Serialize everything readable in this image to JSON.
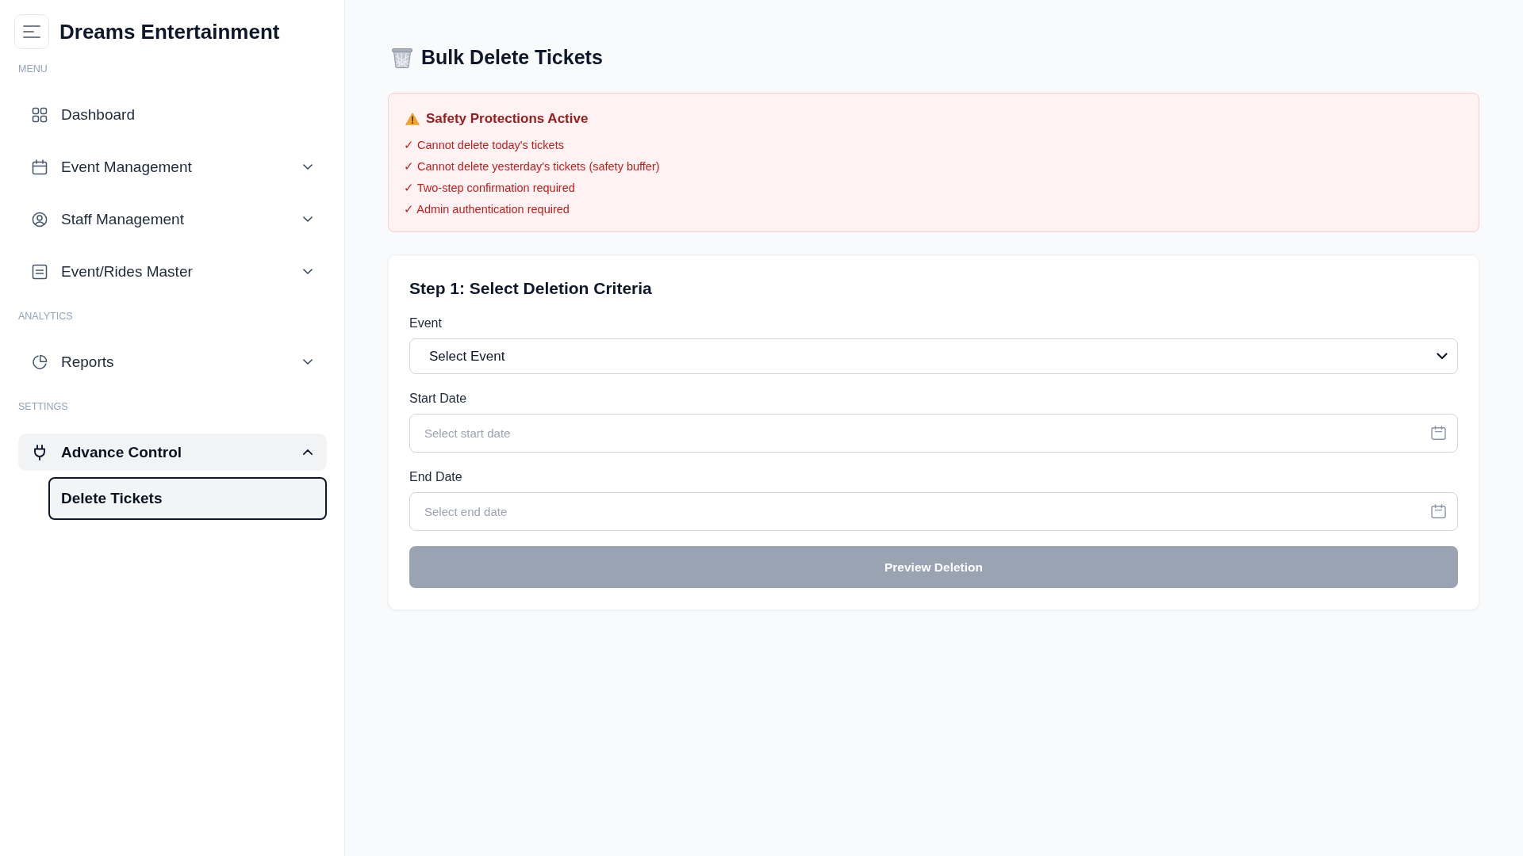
{
  "sidebar": {
    "brand": "Dreams Entertainment",
    "sections": [
      {
        "heading": "MENU",
        "items": [
          {
            "kind": "link",
            "label": "Dashboard",
            "selected": false
          },
          {
            "kind": "group",
            "label": "Event Management",
            "selected": false,
            "expanded": false
          },
          {
            "kind": "group",
            "label": "Staff Management",
            "selected": false,
            "expanded": false
          },
          {
            "kind": "group",
            "label": "Event/Rides Master",
            "selected": false,
            "expanded": false
          }
        ]
      },
      {
        "heading": "ANALYTICS",
        "items": [
          {
            "kind": "group",
            "label": "Reports",
            "selected": false,
            "expanded": false
          }
        ]
      },
      {
        "heading": "SETTINGS",
        "items": [
          {
            "kind": "group",
            "label": "Advance Control",
            "selected": true,
            "expanded": true,
            "children": [
              {
                "label": "Delete Tickets",
                "selected": true
              }
            ]
          }
        ]
      }
    ]
  },
  "page": {
    "title": "Bulk Delete Tickets"
  },
  "alert": {
    "title": "Safety Protections Active",
    "items": [
      "✓ Cannot delete today's tickets",
      "✓ Cannot delete yesterday's tickets (safety buffer)",
      "✓ Two-step confirmation required",
      "✓ Admin authentication required"
    ]
  },
  "form": {
    "title": "Step 1: Select Deletion Criteria",
    "fields": [
      {
        "kind": "select",
        "label": "Event",
        "value": "Select Event"
      },
      {
        "kind": "date",
        "label": "Start Date",
        "placeholder": "Select start date"
      },
      {
        "kind": "date",
        "label": "End Date",
        "placeholder": "Select end date"
      }
    ],
    "submit": {
      "label": "Preview Deletion",
      "disabled": true
    }
  }
}
